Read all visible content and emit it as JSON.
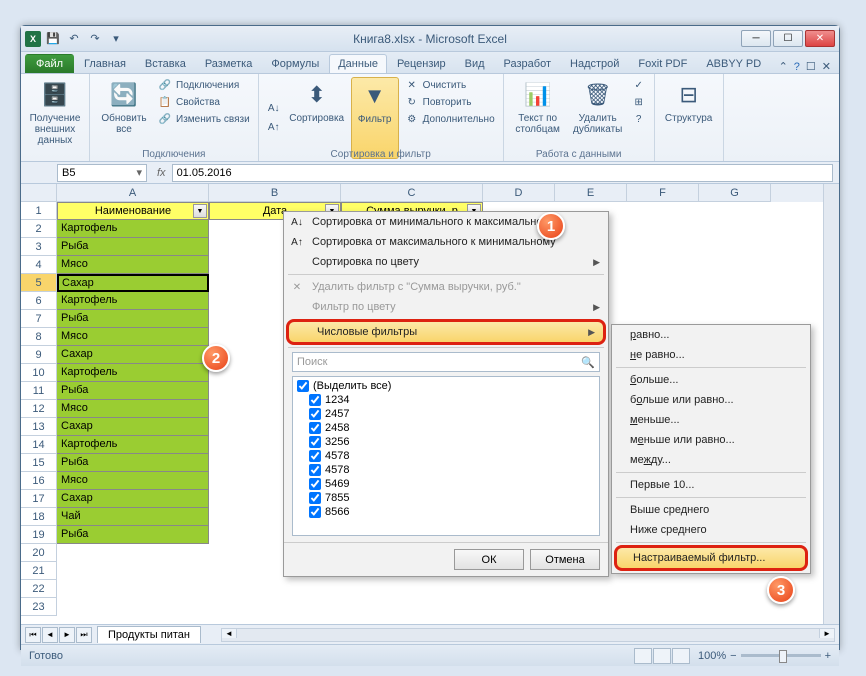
{
  "title": "Книга8.xlsx  -  Microsoft Excel",
  "qat_excel": "X",
  "tabs": {
    "file": "Файл",
    "home": "Главная",
    "insert": "Вставка",
    "layout": "Разметка",
    "formulas": "Формулы",
    "data": "Данные",
    "review": "Рецензир",
    "view": "Вид",
    "dev": "Разработ",
    "addins": "Надстрой",
    "foxit": "Foxit PDF",
    "abbyy": "ABBYY PD"
  },
  "ribbon": {
    "get_external": "Получение внешних данных",
    "refresh_all": "Обновить все",
    "connections": "Подключения",
    "properties": "Свойства",
    "edit_links": "Изменить связи",
    "group_connections": "Подключения",
    "sort": "Сортировка",
    "filter": "Фильтр",
    "clear": "Очистить",
    "reapply": "Повторить",
    "advanced": "Дополнительно",
    "group_sortfilter": "Сортировка и фильтр",
    "text_to_cols": "Текст по столбцам",
    "remove_dups": "Удалить дубликаты",
    "group_datatools": "Работа с данными",
    "outline": "Структура"
  },
  "namebox": "B5",
  "formula": "01.05.2016",
  "columns": [
    "A",
    "B",
    "C",
    "D",
    "E",
    "F",
    "G"
  ],
  "headers": {
    "A": "Наименование",
    "B": "Дата",
    "C": "Сумма выручки, р"
  },
  "rows": [
    "Картофель",
    "Рыба",
    "Мясо",
    "Сахар",
    "Картофель",
    "Рыба",
    "Мясо",
    "Сахар",
    "Картофель",
    "Рыба",
    "Мясо",
    "Сахар",
    "Картофель",
    "Рыба",
    "Мясо",
    "Сахар",
    "Чай",
    "Рыба"
  ],
  "sheettab": "Продукты питан",
  "status": "Готово",
  "zoom": "100%",
  "filter_menu": {
    "sort_asc": "Сортировка от минимального к максимальному",
    "sort_desc": "Сортировка от максимального к минимальному",
    "sort_color": "Сортировка по цвету",
    "clear_filter": "Удалить фильтр с \"Сумма выручки, руб.\"",
    "filter_color": "Фильтр по цвету",
    "number_filters": "Числовые фильтры",
    "search": "Поиск",
    "select_all": "(Выделить все)",
    "items": [
      "1234",
      "2457",
      "2458",
      "3256",
      "4578",
      "4578",
      "5469",
      "7855",
      "8566"
    ],
    "ok": "ОК",
    "cancel": "Отмена"
  },
  "submenu": {
    "equals": "равно...",
    "not_equals": "не равно...",
    "greater": "больше...",
    "greater_eq": "больше или равно...",
    "less": "меньше...",
    "less_eq": "меньше или равно...",
    "between": "между...",
    "top10": "Первые 10...",
    "above_avg": "Выше среднего",
    "below_avg": "Ниже среднего",
    "custom": "Настраиваемый фильтр..."
  },
  "badges": {
    "b1": "1",
    "b2": "2",
    "b3": "3"
  }
}
